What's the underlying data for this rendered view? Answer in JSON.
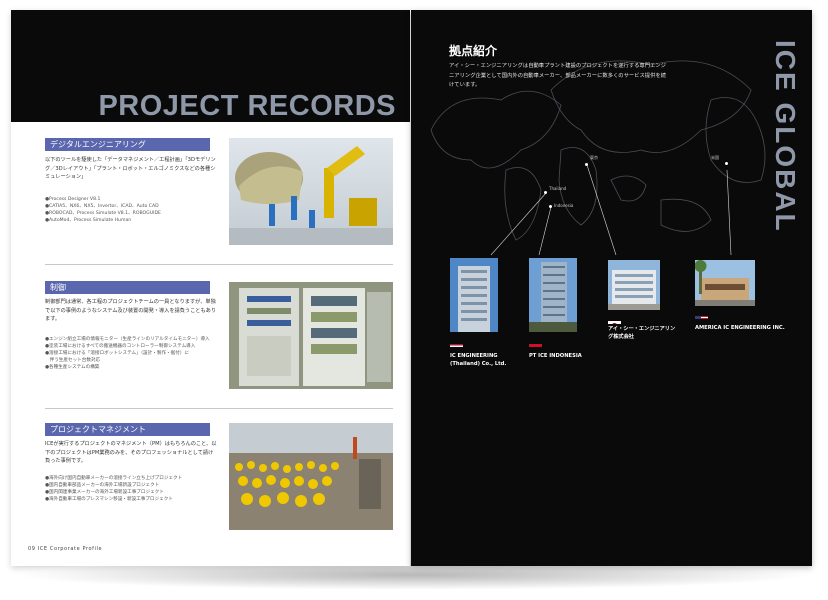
{
  "left_page": {
    "title": "PROJECT RECORDS",
    "footer": "09  ICE Corporate Profile",
    "sections": [
      {
        "heading": "デジタルエンジニアリング",
        "body": "以下のツールを駆使した「データマネジメント／工程計画」「3Dモデリング／3Dレイアウト」「プラント・ロボット・エルゴノミクスなどの各種シミュレーション」",
        "tools": [
          "●Process Designer V8.1",
          "●CATIA5、NX6、NX5、Invertor、ICAD、Auto CAD",
          "●ROBOCAD、Process Simulate V8.1、ROBOGUIDE",
          "●AutoMod、Process Simulate Human"
        ]
      },
      {
        "heading": "制御",
        "body": "制御部門は通常、各工程のプロジェクトチームの一員となりますが、単独で以下の事例のようなシステム及び装置の開発・導入を請負うこともあります。",
        "tools": [
          "●エンジン組立工場の情報モニター（生産ラインのリアルタイムモニター）導入",
          "●塗装工場におけるすべての搬送機器のコントローラー制御システム導入",
          "●溶接工場における「溶接ロボットシステム」（設計・製作・据付）に",
          "　伴う生産セット台数対応",
          "●各種生産システムの構築"
        ]
      },
      {
        "heading": "プロジェクトマネジメント",
        "body": "ICEが実行するプロジェクトのマネジメント（PM）はもちろんのこと、以下のプロジェクトはPM業務のみを、そのプロフェッショナルとして請け負った事例です。",
        "tools": [
          "●海外向け国内自動車メーカーの溶接ライン立ち上げプロジェクト",
          "●国内自動車部品メーカーの海外工場新設プロジェクト",
          "●国内関連事業メーカーの海外工場新設工事プロジェクト",
          "●海外自動車工場のプレスマシン移設・新設工事プロジェクト"
        ]
      }
    ]
  },
  "right_page": {
    "title": "拠点紹介",
    "description": "アイ・シー・エンジニアリングは自動車プラント建設のプロジェクトを遂行する専門エンジニアリング企業として国内外の自動車メーカー、部品メーカーに数多くのサービス提供を続けています。",
    "vertical_title": "ICE GLOBAL",
    "cities": [
      "Thailand",
      "Indonesia",
      "東京",
      "米国"
    ],
    "offices": [
      {
        "name": "IC ENGINEERING (Thailand) Co., Ltd.",
        "flag": "thailand-flag"
      },
      {
        "name": "PT ICE INDONESIA",
        "flag": "indonesia-flag"
      },
      {
        "name": "アイ・シー・エンジニアリング株式会社",
        "flag": "japan-flag"
      },
      {
        "name": "AMERICA IC ENGINEERING INC.",
        "flag": "usa-flag"
      }
    ]
  },
  "colors": {
    "section_heading_bg": "#5a66ad",
    "title_gray": "#8e98a8",
    "page_dark": "#0a0a0a"
  }
}
